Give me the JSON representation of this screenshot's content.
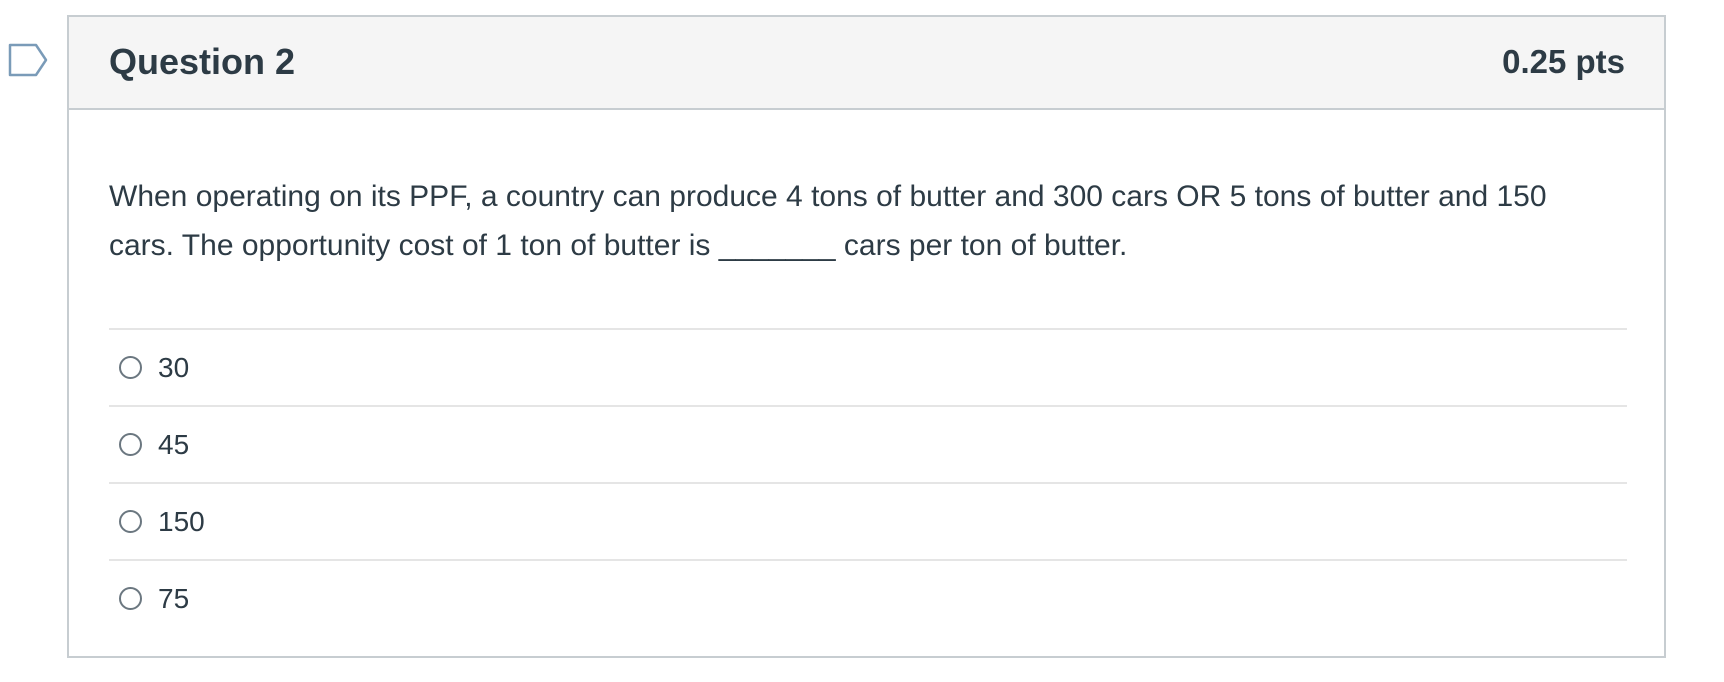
{
  "question": {
    "title": "Question 2",
    "points": "0.25 pts",
    "text": "When operating on its PPF, a country can produce 4 tons of butter and 300 cars OR 5 tons of butter and 150 cars. The opportunity cost of 1 ton of butter is _______ cars per ton of butter.",
    "flag_icon": "flag-outline-icon",
    "accent_color": "#7a9bb8"
  },
  "answers": [
    {
      "label": "30",
      "selected": false
    },
    {
      "label": "45",
      "selected": false
    },
    {
      "label": "150",
      "selected": false
    },
    {
      "label": "75",
      "selected": false
    }
  ]
}
